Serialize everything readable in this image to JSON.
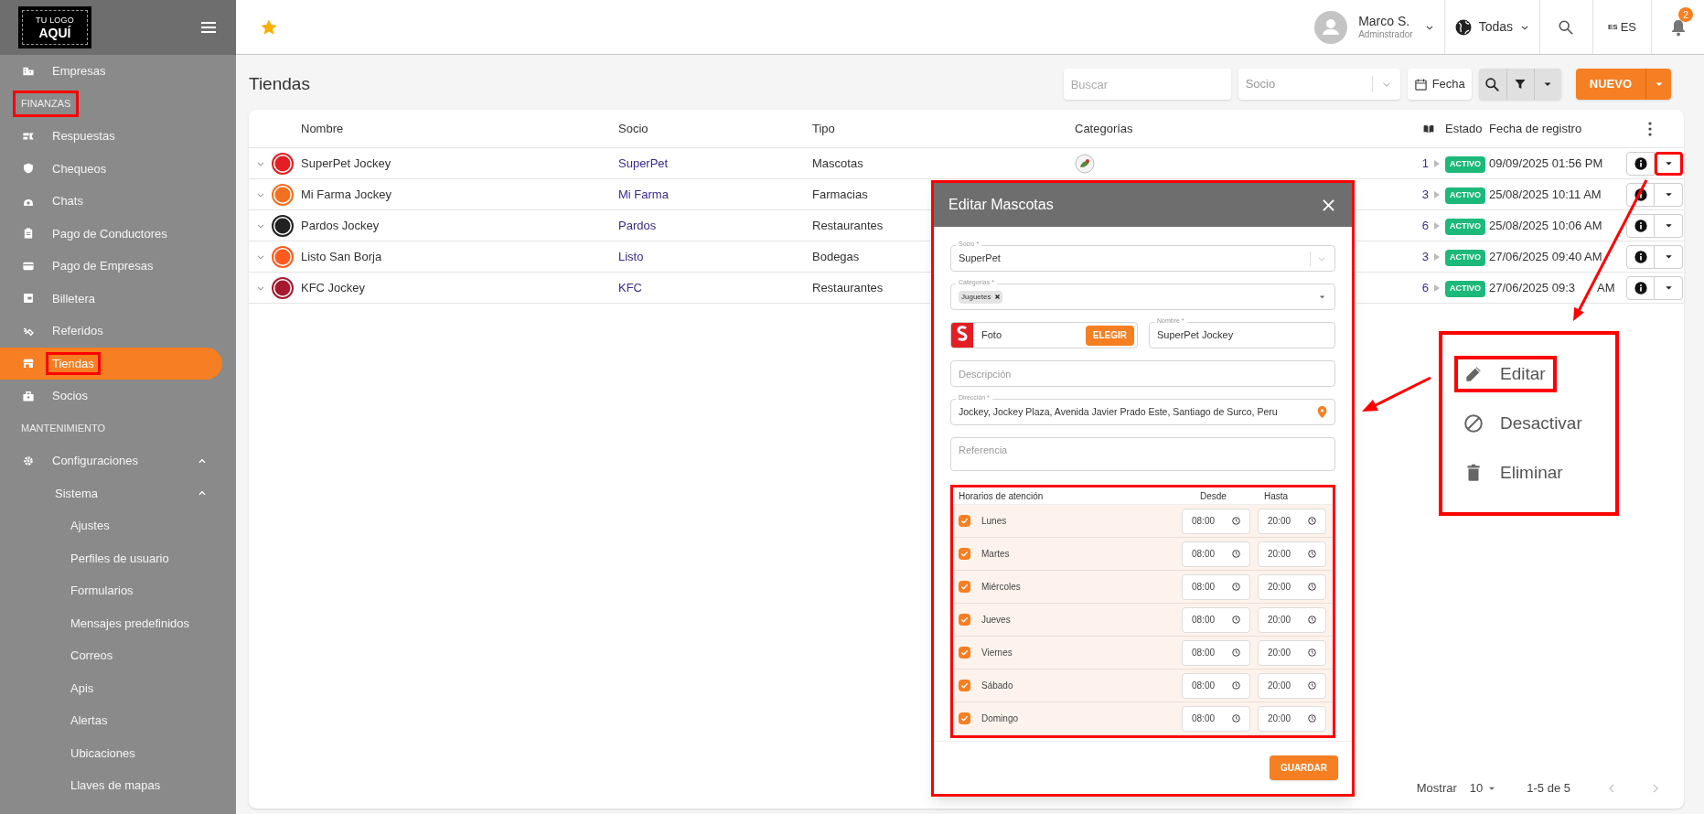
{
  "sidebar": {
    "logo": {
      "line1": "TU LOGO",
      "line2": "AQUÍ"
    },
    "items": [
      {
        "kind": "item",
        "label": "Empresas",
        "selected": false
      },
      {
        "kind": "section",
        "label": "FINANZAS",
        "highlighted": true
      },
      {
        "kind": "item",
        "label": "Respuestas",
        "selected": false
      },
      {
        "kind": "item",
        "label": "Chequeos",
        "selected": false
      },
      {
        "kind": "item",
        "label": "Chats",
        "selected": false
      },
      {
        "kind": "item",
        "label": "Pago de Conductores",
        "selected": false
      },
      {
        "kind": "item",
        "label": "Pago de Empresas",
        "selected": false
      },
      {
        "kind": "item",
        "label": "Billetera",
        "selected": false
      },
      {
        "kind": "item",
        "label": "Referidos",
        "selected": false
      },
      {
        "kind": "item",
        "label": "Tiendas",
        "selected": true,
        "highlighted": true
      },
      {
        "kind": "item",
        "label": "Socios",
        "selected": false
      },
      {
        "kind": "section",
        "label": "MANTENIMIENTO"
      },
      {
        "kind": "item",
        "label": "Configuraciones",
        "selected": false,
        "expanded": true,
        "children": [
          {
            "kind": "item",
            "label": "Sistema",
            "selected": false,
            "expanded": true,
            "children": [
              {
                "kind": "item",
                "label": "Ajustes",
                "selected": false
              },
              {
                "kind": "item",
                "label": "Perfiles de usuario",
                "selected": false
              },
              {
                "kind": "item",
                "label": "Formularios",
                "selected": false
              },
              {
                "kind": "item",
                "label": "Mensajes predefinidos",
                "selected": false
              },
              {
                "kind": "item",
                "label": "Correos",
                "selected": false
              },
              {
                "kind": "item",
                "label": "Apis",
                "selected": false
              },
              {
                "kind": "item",
                "label": "Alertas",
                "selected": false
              },
              {
                "kind": "item",
                "label": "Ubicaciones",
                "selected": false
              },
              {
                "kind": "item",
                "label": "Llaves de mapas",
                "selected": false
              }
            ]
          }
        ]
      }
    ]
  },
  "topbar": {
    "user": {
      "name": "Marco S.",
      "role": "Adminstrador"
    },
    "region": "Todas",
    "language": {
      "flag": "ES",
      "label": "ES"
    },
    "notifications": "2"
  },
  "page": {
    "title": "Tiendas",
    "search": {
      "placeholder": "Buscar"
    },
    "socio_filter": {
      "placeholder": "Socio"
    },
    "date_button": "Fecha",
    "new_button": "NUEVO"
  },
  "table": {
    "columns": [
      "Nombre",
      "Socio",
      "Tipo",
      "Categorías",
      "Estado",
      "Fecha de registro"
    ],
    "rows": [
      {
        "name": "SuperPet Jockey",
        "color": "#e31e24",
        "socio": "SuperPet",
        "tipo": "Mascotas",
        "category_icon": true,
        "count": "1",
        "estado": "ACTIVO",
        "fecha": "09/09/2025 01:56 PM",
        "menu_highlighted": true
      },
      {
        "name": "Mi Farma Jockey",
        "color": "#f37021",
        "socio": "Mi Farma",
        "tipo": "Farmacias",
        "count": "3",
        "estado": "ACTIVO",
        "fecha": "25/08/2025 10:11 AM"
      },
      {
        "name": "Pardos Jockey",
        "color": "#222222",
        "socio": "Pardos",
        "tipo": "Restaurantes",
        "count": "6",
        "estado": "ACTIVO",
        "fecha": "25/08/2025 10:06 AM"
      },
      {
        "name": "Listo San Borja",
        "color": "#ff5a1f",
        "socio": "Listo",
        "tipo": "Bodegas",
        "count": "3",
        "estado": "ACTIVO",
        "fecha": "27/06/2025 09:40 AM"
      },
      {
        "name": "KFC Jockey",
        "color": "#a6192e",
        "socio": "KFC",
        "tipo": "Restaurantes",
        "count": "6",
        "estado": "ACTIVO",
        "fecha": "27/06/2025 09:3",
        "fecha_tail": "AM"
      }
    ],
    "pagination": {
      "label": "Mostrar",
      "page_size": "10",
      "range": "1-5 de 5"
    }
  },
  "modal": {
    "title": "Editar Mascotas",
    "highlighted": true,
    "socio": {
      "label": "Socio *",
      "value": "SuperPet"
    },
    "categorias": {
      "label": "Categorías *",
      "chips": [
        "Juguetes"
      ]
    },
    "foto": {
      "label": "Foto",
      "button": "ELEGIR"
    },
    "nombre": {
      "label": "Nombre *",
      "value": "SuperPet Jockey"
    },
    "descripcion": {
      "placeholder": "Descripción"
    },
    "direccion": {
      "label": "Dirección *",
      "value": "Jockey, Jockey Plaza, Avenida Javier Prado Este, Santiago de Surco, Peru"
    },
    "referencia": {
      "placeholder": "Referencia"
    },
    "hours": {
      "highlighted": true,
      "headers": [
        "Horarios de atención",
        "Desde",
        "Hasta"
      ],
      "days": [
        {
          "day": "Lunes",
          "checked": true,
          "from": "08:00",
          "to": "20:00"
        },
        {
          "day": "Martes",
          "checked": true,
          "from": "08:00",
          "to": "20:00"
        },
        {
          "day": "Miércoles",
          "checked": true,
          "from": "08:00",
          "to": "20:00"
        },
        {
          "day": "Jueves",
          "checked": true,
          "from": "08:00",
          "to": "20:00"
        },
        {
          "day": "Viernes",
          "checked": true,
          "from": "08:00",
          "to": "20:00"
        },
        {
          "day": "Sábado",
          "checked": true,
          "from": "08:00",
          "to": "20:00"
        },
        {
          "day": "Domingo",
          "checked": true,
          "from": "08:00",
          "to": "20:00"
        }
      ]
    },
    "save_button": "GUARDAR"
  },
  "action_menu": {
    "highlighted": true,
    "items": [
      {
        "label": "Editar",
        "highlighted": true
      },
      {
        "label": "Desactivar"
      },
      {
        "label": "Eliminar"
      }
    ]
  }
}
